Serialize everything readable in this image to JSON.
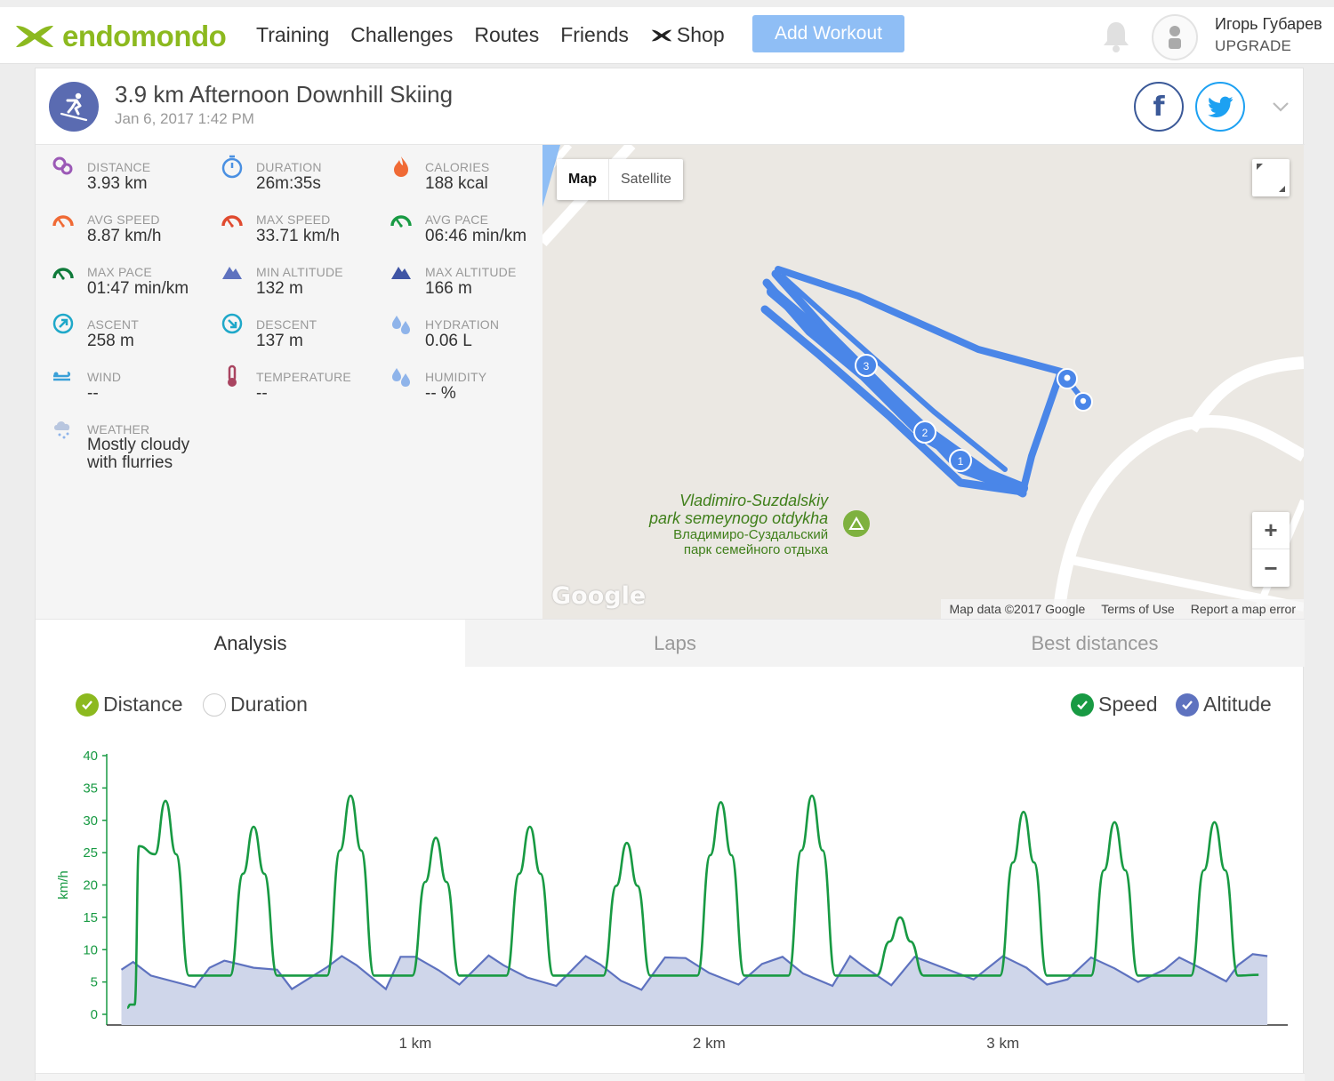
{
  "nav": {
    "brand": "endomondo",
    "items": [
      "Training",
      "Challenges",
      "Routes",
      "Friends",
      "Shop"
    ],
    "add_workout": "Add Workout",
    "user_name": "Игорь Губарев",
    "upgrade": "UPGRADE"
  },
  "workout": {
    "title": "3.9 km Afternoon Downhill Skiing",
    "date": "Jan 6, 2017 1:42 PM"
  },
  "stats": [
    {
      "label": "DISTANCE",
      "value": "3.93 km",
      "icon": "distance-icon",
      "color": "#9b59b6"
    },
    {
      "label": "DURATION",
      "value": "26m:35s",
      "icon": "stopwatch-icon",
      "color": "#4a90e2"
    },
    {
      "label": "CALORIES",
      "value": "188 kcal",
      "icon": "flame-icon",
      "color": "#f06a35"
    },
    {
      "label": "AVG SPEED",
      "value": "8.87 km/h",
      "icon": "speedometer-icon",
      "color": "#f06a35"
    },
    {
      "label": "MAX SPEED",
      "value": "33.71 km/h",
      "icon": "speedometer-icon",
      "color": "#e04a2f"
    },
    {
      "label": "AVG PACE",
      "value": "06:46 min/km",
      "icon": "speedometer-icon",
      "color": "#189a43"
    },
    {
      "label": "MAX PACE",
      "value": "01:47 min/km",
      "icon": "speedometer-icon",
      "color": "#0f7a3a"
    },
    {
      "label": "MIN ALTITUDE",
      "value": "132 m",
      "icon": "mountain-icon",
      "color": "#5e72bf"
    },
    {
      "label": "MAX ALTITUDE",
      "value": "166 m",
      "icon": "mountain-icon",
      "color": "#3f55a5"
    },
    {
      "label": "ASCENT",
      "value": "258 m",
      "icon": "ascent-icon",
      "color": "#1fa8c9"
    },
    {
      "label": "DESCENT",
      "value": "137 m",
      "icon": "descent-icon",
      "color": "#1fa8c9"
    },
    {
      "label": "HYDRATION",
      "value": "0.06 L",
      "icon": "water-drops-icon",
      "color": "#8fb4ea"
    },
    {
      "label": "WIND",
      "value": "--",
      "icon": "wind-icon",
      "color": "#3aa0d8"
    },
    {
      "label": "TEMPERATURE",
      "value": "--",
      "icon": "thermometer-icon",
      "color": "#a94460"
    },
    {
      "label": "HUMIDITY",
      "value": "-- %",
      "icon": "water-drops-icon",
      "color": "#8fb4ea"
    },
    {
      "label": "WEATHER",
      "value": "Mostly cloudy with flurries",
      "icon": "snow-cloud-icon",
      "color": "#b8c6df"
    }
  ],
  "map": {
    "type_map": "Map",
    "type_satellite": "Satellite",
    "park_name_en_1": "Vladimiro-Suzdalskiy",
    "park_name_en_2": "park semeynogo otdykha",
    "park_name_ru_1": "Владимиро-Суздальский",
    "park_name_ru_2": "парк семейного отдыха",
    "google": "Google",
    "footer": [
      "Map data ©2017 Google",
      "Terms of Use",
      "Report a map error"
    ],
    "route_color": "#4a86e8",
    "lap_markers": [
      "1",
      "2",
      "3"
    ]
  },
  "tabs": [
    "Analysis",
    "Laps",
    "Best distances"
  ],
  "analysis": {
    "x_mode_distance": "Distance",
    "x_mode_duration": "Duration",
    "series_speed": "Speed",
    "series_altitude": "Altitude"
  },
  "chart_data": {
    "type": "line",
    "ylabel": "km/h",
    "ylim": [
      0,
      40
    ],
    "y_ticks": [
      "0",
      "5",
      "10",
      "15",
      "20",
      "25",
      "30",
      "35",
      "40"
    ],
    "x_ticks": [
      {
        "x": 1,
        "label": "1 km"
      },
      {
        "x": 2,
        "label": "2 km"
      },
      {
        "x": 3,
        "label": "3 km"
      }
    ],
    "xlim": [
      -0.05,
      3.93
    ],
    "series": [
      {
        "name": "Speed",
        "color": "#189a43",
        "peaks": [
          {
            "x": 0.15,
            "y": 33.0
          },
          {
            "x": 0.45,
            "y": 29.0
          },
          {
            "x": 0.78,
            "y": 33.8
          },
          {
            "x": 1.07,
            "y": 27.3
          },
          {
            "x": 1.39,
            "y": 29.0
          },
          {
            "x": 1.72,
            "y": 26.5
          },
          {
            "x": 2.04,
            "y": 32.8
          },
          {
            "x": 2.35,
            "y": 33.8
          },
          {
            "x": 2.65,
            "y": 15.0
          },
          {
            "x": 3.07,
            "y": 31.3
          },
          {
            "x": 3.38,
            "y": 29.7
          },
          {
            "x": 3.72,
            "y": 29.7
          }
        ]
      },
      {
        "name": "Altitude",
        "color": "#5e72bf",
        "x": [
          0.0,
          0.04,
          0.1,
          0.25,
          0.3,
          0.35,
          0.45,
          0.53,
          0.58,
          0.7,
          0.75,
          0.8,
          0.9,
          0.95,
          1.0,
          1.08,
          1.15,
          1.25,
          1.3,
          1.38,
          1.48,
          1.58,
          1.63,
          1.7,
          1.77,
          1.85,
          1.92,
          2.0,
          2.1,
          2.18,
          2.25,
          2.32,
          2.42,
          2.48,
          2.52,
          2.62,
          2.7,
          2.82,
          2.9,
          3.0,
          3.08,
          3.15,
          3.22,
          3.3,
          3.38,
          3.46,
          3.55,
          3.6,
          3.68,
          3.76,
          3.8,
          3.85,
          3.9
        ],
        "values": [
          6.9,
          8.1,
          6.0,
          4.2,
          7.2,
          8.3,
          7.2,
          6.9,
          3.9,
          7.3,
          9.0,
          7.6,
          3.9,
          8.9,
          8.9,
          6.8,
          4.6,
          9.1,
          7.6,
          5.7,
          4.4,
          9.0,
          7.7,
          5.2,
          3.8,
          8.8,
          8.7,
          6.4,
          4.6,
          7.8,
          8.9,
          6.3,
          4.4,
          9.0,
          7.6,
          4.5,
          8.9,
          6.8,
          5.4,
          9.0,
          7.2,
          4.6,
          5.4,
          8.8,
          7.1,
          5.0,
          6.9,
          8.8,
          7.0,
          5.1,
          7.6,
          9.3,
          9.0
        ]
      }
    ]
  }
}
